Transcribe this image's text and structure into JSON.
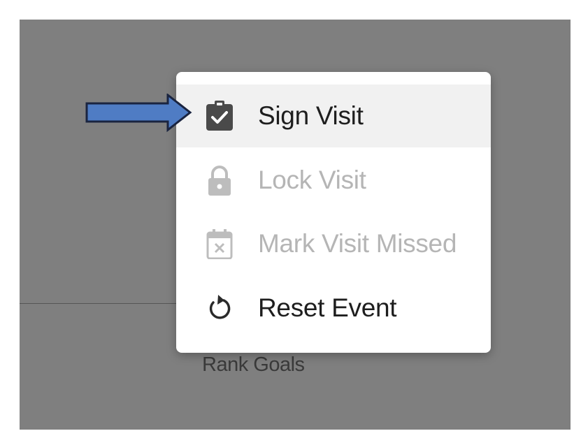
{
  "menu": {
    "items": [
      {
        "label": "Sign Visit",
        "icon": "clipboard-check-icon",
        "enabled": true,
        "highlighted": true
      },
      {
        "label": "Lock Visit",
        "icon": "lock-icon",
        "enabled": false
      },
      {
        "label": "Mark Visit Missed",
        "icon": "calendar-x-icon",
        "enabled": false
      },
      {
        "label": "Reset Event",
        "icon": "reset-icon",
        "enabled": true
      }
    ]
  },
  "background": {
    "label": "Rank Goals"
  },
  "annotation": {
    "arrow_color": "#4f7cc4",
    "arrow_outline": "#1a2440",
    "points_to": "Sign Visit"
  },
  "colors": {
    "overlay": "#7f7f7f",
    "menu_bg": "#ffffff",
    "highlight": "#f1f1f1",
    "text_enabled": "#1e1e1e",
    "text_disabled": "#b5b5b5"
  }
}
